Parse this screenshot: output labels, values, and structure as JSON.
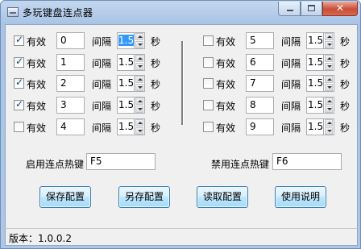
{
  "window": {
    "title": "多玩键盘连点器",
    "minimize_glyph": "",
    "maximize_glyph": "",
    "close_glyph": "✕"
  },
  "labels": {
    "valid": "有效",
    "interval": "间隔",
    "seconds": "秒"
  },
  "rows": [
    {
      "checked": true,
      "key": "0",
      "interval": "1.5",
      "selected": true
    },
    {
      "checked": true,
      "key": "1",
      "interval": "1.5",
      "selected": false
    },
    {
      "checked": true,
      "key": "2",
      "interval": "1.5",
      "selected": false
    },
    {
      "checked": true,
      "key": "3",
      "interval": "1.5",
      "selected": false
    },
    {
      "checked": false,
      "key": "4",
      "interval": "1.5",
      "selected": false
    },
    {
      "checked": false,
      "key": "5",
      "interval": "1.5",
      "selected": false
    },
    {
      "checked": false,
      "key": "6",
      "interval": "1.5",
      "selected": false
    },
    {
      "checked": false,
      "key": "7",
      "interval": "1.5",
      "selected": false
    },
    {
      "checked": false,
      "key": "8",
      "interval": "1.5",
      "selected": false
    },
    {
      "checked": false,
      "key": "9",
      "interval": "1.5",
      "selected": false
    }
  ],
  "hotkeys": {
    "enable_label": "启用连点热键",
    "enable_value": "F5",
    "disable_label": "禁用连点热键",
    "disable_value": "F6"
  },
  "buttons": {
    "save": "保存配置",
    "save_as": "另存配置",
    "load": "读取配置",
    "help": "使用说明"
  },
  "status": {
    "version": "版本：1.0.0.2"
  }
}
